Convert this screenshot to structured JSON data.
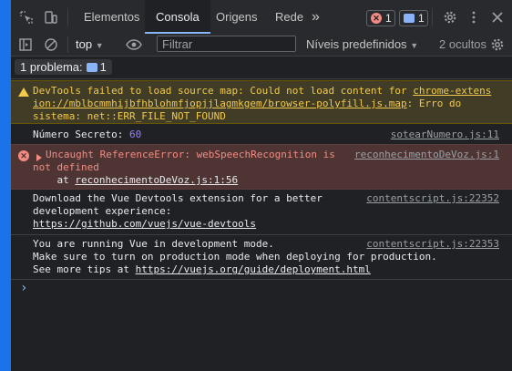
{
  "tabs": [
    "Elementos",
    "Consola",
    "Origens",
    "Rede"
  ],
  "more_tabs": "»",
  "error_count": "1",
  "info_count": "1",
  "toolbar": {
    "context": "top",
    "filter_placeholder": "Filtrar",
    "levels": "Níveis predefinidos",
    "hidden": "2 ocultos"
  },
  "issues": {
    "label": "1 problema:",
    "count": "1"
  },
  "messages": {
    "warning": {
      "l1": "DevTools failed to load source map: Could not load content for ",
      "l1_link": "chrome-extens",
      "l2_link": "ion://mblbcmmhijbfhblohmfjopjjlagmkgem/browser-polyfill.js.map",
      "l2_rest": ": Erro do",
      "l3": "sistema: net::ERR_FILE_NOT_FOUND"
    },
    "log1": {
      "label": "Número Secreto: ",
      "value": "60",
      "source": "sotearNumero.js:11"
    },
    "error": {
      "l1": "Uncaught ReferenceError: webSpeechRecognition is",
      "l2": "not defined",
      "l3_prefix": "    at ",
      "l3_link": "reconhecimentoDeVoz.js:1:56",
      "source": "reconhecimentoDeVoz.js:1"
    },
    "log2": {
      "l1": "Download the Vue Devtools extension for a better",
      "l2": "development experience:",
      "l3": "https://github.com/vuejs/vue-devtools",
      "source": "contentscript.js:22352"
    },
    "log3": {
      "l1": "You are running Vue in development mode.",
      "l2": "Make sure to turn on production mode when deploying for production.",
      "l3_prefix": "See more tips at ",
      "l3_link": "https://vuejs.org/guide/deployment.html",
      "source": "contentscript.js:22353"
    }
  },
  "colors": {
    "accent": "#1a73e8",
    "warning": "#f2c94c",
    "error": "#f28b82",
    "number": "#9980ff"
  },
  "icons": [
    "inspect-icon",
    "device-toggle-icon",
    "error-icon",
    "message-icon",
    "settings-icon",
    "kebab-icon",
    "close-icon",
    "sidebar-icon",
    "clear-icon",
    "eye-icon",
    "settings-icon"
  ]
}
